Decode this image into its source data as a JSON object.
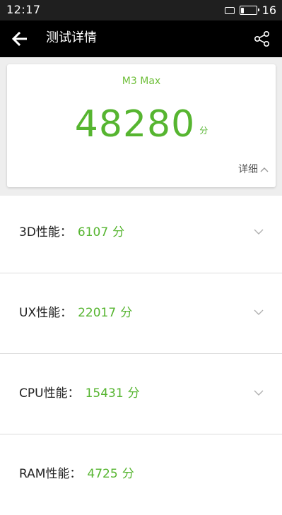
{
  "status_bar": {
    "time": "12:17",
    "battery_level": "16",
    "battery_fraction": 0.16
  },
  "header": {
    "title": "测试详情",
    "back_icon": "arrow-left-icon",
    "share_icon": "share-icon"
  },
  "summary": {
    "device_name": "M3 Max",
    "total_score": "48280",
    "unit": "分",
    "detail_label": "详细",
    "detail_icon": "chevron-up-icon"
  },
  "categories": [
    {
      "label": "3D性能：",
      "score": "6107",
      "unit": "分"
    },
    {
      "label": "UX性能：",
      "score": "22017",
      "unit": "分"
    },
    {
      "label": "CPU性能：",
      "score": "15431",
      "unit": "分"
    },
    {
      "label": "RAM性能：",
      "score": "4725",
      "unit": "分"
    }
  ],
  "colors": {
    "accent_green": "#56b530",
    "header_bg": "#000000",
    "status_bg": "#1f1f1f"
  }
}
